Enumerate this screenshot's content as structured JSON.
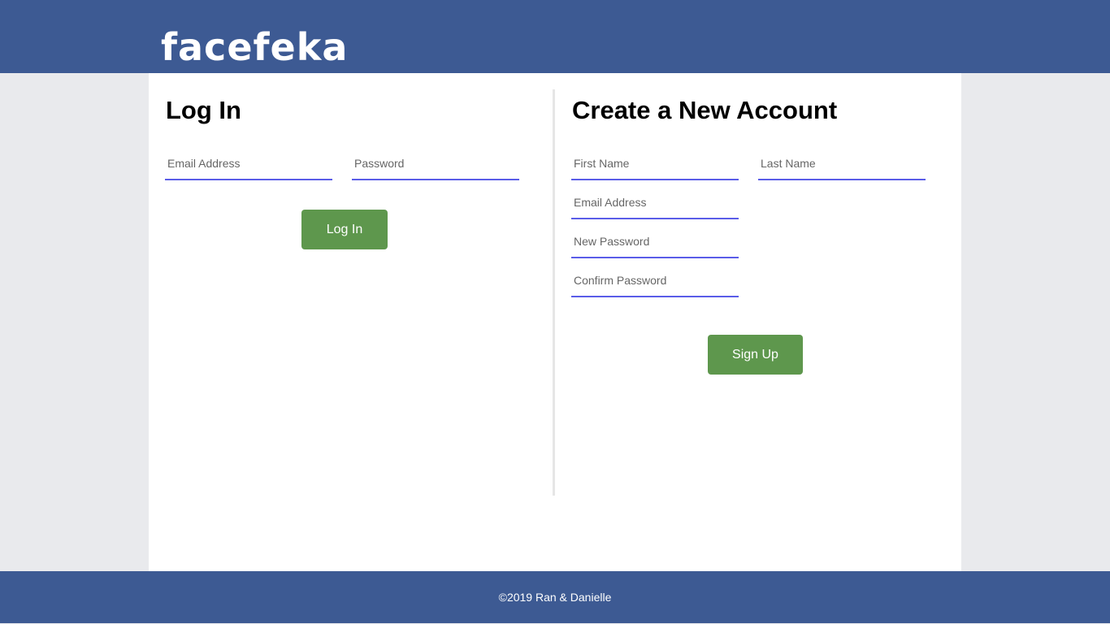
{
  "header": {
    "logo": "facefeka",
    "background_color": "#3d5a93"
  },
  "login": {
    "title": "Log In",
    "email_placeholder": "Email Address",
    "password_placeholder": "Password",
    "button_label": "Log In"
  },
  "signup": {
    "title": "Create a New Account",
    "first_name_placeholder": "First Name",
    "last_name_placeholder": "Last Name",
    "email_placeholder": "Email Address",
    "new_password_placeholder": "New Password",
    "confirm_password_placeholder": "Confirm Password",
    "button_label": "Sign Up"
  },
  "footer": {
    "text": "©2019 Ran & Danielle"
  },
  "colors": {
    "accent_underline": "#5a5de8",
    "button_green": "#5e974d",
    "page_background": "#e9eaed"
  }
}
